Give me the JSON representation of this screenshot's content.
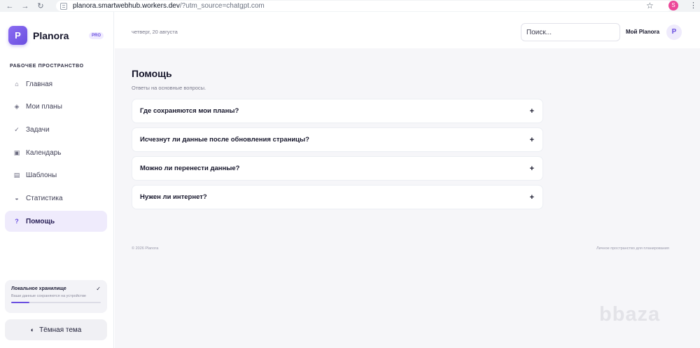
{
  "browser": {
    "back_icon": "arrow-left-icon",
    "url_host": "planora.smartwebhub.workers.dev",
    "url_path": "/?utm_source=chatgpt.com",
    "profile_initial": "S"
  },
  "sidebar": {
    "brand_initial": "P",
    "brand_name": "Planora",
    "brand_badge": "PRO",
    "section_title": "РАБОЧЕЕ ПРОСТРАНСТВО",
    "items": [
      {
        "label": "Главная",
        "icon": "home-icon",
        "glyph": "⌂",
        "active": false
      },
      {
        "label": "Мои планы",
        "icon": "diamond-icon",
        "glyph": "◈",
        "active": false
      },
      {
        "label": "Задачи",
        "icon": "check-icon",
        "glyph": "✓",
        "active": false
      },
      {
        "label": "Календарь",
        "icon": "calendar-icon",
        "glyph": "▣",
        "active": false
      },
      {
        "label": "Шаблоны",
        "icon": "template-icon",
        "glyph": "▤",
        "active": false
      },
      {
        "label": "Статистика",
        "icon": "chart-icon",
        "glyph": "◒",
        "active": false
      },
      {
        "label": "Помощь",
        "icon": "help-icon",
        "glyph": "?",
        "active": true
      }
    ],
    "storage": {
      "title": "Локальное хранилище",
      "subtitle": "Ваши данные сохраняются на устройстве",
      "progress": 0.2
    },
    "theme_button_label": "Тёмная тема"
  },
  "header": {
    "date": "четверг, 20 августа",
    "search_placeholder": "Поиск...",
    "user_name": "Мой Planora",
    "avatar_initial": "P"
  },
  "main": {
    "title": "Помощь",
    "subtitle": "Ответы на основные вопросы.",
    "faq": [
      {
        "question": "Где сохраняются мои планы?"
      },
      {
        "question": "Исчезнут ли данные после обновления страницы?"
      },
      {
        "question": "Можно ли перенести данные?"
      },
      {
        "question": "Нужен ли интернет?"
      }
    ],
    "expand_glyph": "+"
  },
  "footer": {
    "left": "© 2026 Planora",
    "right": "Личное пространство для планирования"
  },
  "watermark": "bbaza"
}
